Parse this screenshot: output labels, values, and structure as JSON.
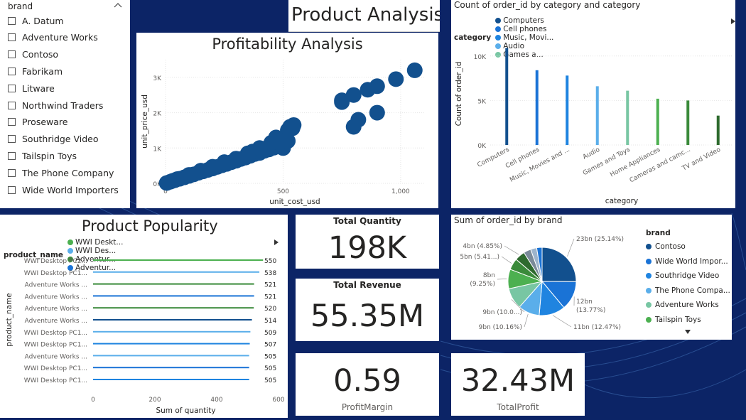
{
  "colors": {
    "background": "#0c2466",
    "scatter": "#12508e",
    "category_colors": [
      "#12508e",
      "#1a73d6",
      "#1f84e0",
      "#5aaeea",
      "#78c6a3",
      "#4cb050",
      "#3a8a3a",
      "#2e6a2e"
    ]
  },
  "brand_slicer": {
    "title": "brand",
    "collapse_icon": "chevron-up-icon",
    "items": [
      "A. Datum",
      "Adventure Works",
      "Contoso",
      "Fabrikam",
      "Litware",
      "Northwind Traders",
      "Proseware",
      "Southridge Video",
      "Tailspin Toys",
      "The Phone Company",
      "Wide World Importers"
    ]
  },
  "page_title": "Product Analysis",
  "profitability": {
    "title": "Profitability Analysis",
    "chart_data": {
      "type": "scatter",
      "title": "Profitability Analysis",
      "xlabel": "unit_cost_usd",
      "ylabel": "unit_price_usd",
      "x_ticks": [
        "0",
        "500",
        "1,000"
      ],
      "y_ticks": [
        "0K",
        "1K",
        "2K",
        "3K"
      ],
      "xlim": [
        0,
        1100
      ],
      "ylim": [
        0,
        3500
      ],
      "points": [
        [
          5,
          10
        ],
        [
          20,
          45
        ],
        [
          40,
          90
        ],
        [
          60,
          130
        ],
        [
          80,
          170
        ],
        [
          100,
          210
        ],
        [
          120,
          255
        ],
        [
          140,
          300
        ],
        [
          160,
          340
        ],
        [
          180,
          380
        ],
        [
          200,
          420
        ],
        [
          220,
          465
        ],
        [
          240,
          510
        ],
        [
          260,
          550
        ],
        [
          280,
          600
        ],
        [
          300,
          640
        ],
        [
          320,
          690
        ],
        [
          340,
          730
        ],
        [
          360,
          780
        ],
        [
          380,
          830
        ],
        [
          400,
          860
        ],
        [
          420,
          920
        ],
        [
          440,
          960
        ],
        [
          460,
          1010
        ],
        [
          480,
          1050
        ],
        [
          500,
          1110
        ],
        [
          510,
          1150
        ],
        [
          520,
          1500
        ],
        [
          540,
          1560
        ],
        [
          530,
          1600
        ],
        [
          545,
          1650
        ],
        [
          490,
          1200
        ],
        [
          470,
          1300
        ],
        [
          450,
          1150
        ],
        [
          430,
          1000
        ],
        [
          400,
          950
        ],
        [
          370,
          900
        ],
        [
          350,
          850
        ],
        [
          300,
          700
        ],
        [
          250,
          600
        ],
        [
          200,
          470
        ],
        [
          150,
          360
        ],
        [
          100,
          240
        ],
        [
          50,
          120
        ],
        [
          30,
          70
        ],
        [
          400,
          1000
        ],
        [
          500,
          1000
        ],
        [
          980,
          2950
        ],
        [
          1060,
          3200
        ],
        [
          750,
          2350
        ],
        [
          800,
          2500
        ],
        [
          860,
          2650
        ],
        [
          900,
          2750
        ],
        [
          750,
          2300
        ],
        [
          820,
          1800
        ],
        [
          800,
          1600
        ],
        [
          900,
          2000
        ],
        [
          520,
          1200
        ]
      ]
    }
  },
  "category_chart": {
    "title": "Count of order_id by category and category",
    "legend_label": "category",
    "legend_items": [
      {
        "name": "Computers",
        "color": "#12508e"
      },
      {
        "name": "Cell phones",
        "color": "#1a73d6"
      },
      {
        "name": "Music, Movi...",
        "color": "#1f84e0"
      },
      {
        "name": "Audio",
        "color": "#5aaeea"
      },
      {
        "name": "Games a...",
        "color": "#78c6a3"
      }
    ],
    "legend_more_icon": "triangle-right-icon",
    "chart_data": {
      "type": "bar",
      "title": "Count of order_id by category and category",
      "xlabel": "category",
      "ylabel": "Count of order_id",
      "y_ticks": [
        "0K",
        "5K",
        "10K"
      ],
      "ylim": [
        0,
        11500
      ],
      "categories": [
        "Computers",
        "Cell phones",
        "Music, Movies and ...",
        "Audio",
        "Games and Toys",
        "Home Appliances",
        "Cameras and camc...",
        "TV and Video"
      ],
      "values": [
        10900,
        8400,
        7800,
        6600,
        6100,
        5200,
        5000,
        3300
      ],
      "colors": [
        "#12508e",
        "#1a73d6",
        "#1f84e0",
        "#5aaeea",
        "#78c6a3",
        "#4cb050",
        "#3a8a3a",
        "#2e6a2e"
      ]
    }
  },
  "popularity": {
    "title": "Product Popularity",
    "legend_label": "product_name",
    "legend_items": [
      {
        "name": "WWI Deskt...",
        "color": "#4cb050"
      },
      {
        "name": "WWI Des...",
        "color": "#5aaeea"
      },
      {
        "name": "Adventur...",
        "color": "#3a8a3a"
      },
      {
        "name": "Adventur...",
        "color": "#1a73d6"
      }
    ],
    "legend_more_icon": "triangle-right-icon",
    "chart_data": {
      "type": "bar",
      "orientation": "horizontal",
      "xlabel": "Sum of quantity",
      "ylabel": "product_name",
      "x_ticks": [
        "0",
        "200",
        "400",
        "600"
      ],
      "xlim": [
        0,
        600
      ],
      "categories": [
        "WWI Desktop PC2...",
        "WWI Desktop PC1...",
        "Adventure Works ...",
        "Adventure Works ...",
        "Adventure Works ...",
        "Adventure Works ...",
        "WWI Desktop PC1...",
        "WWI Desktop PC1...",
        "Adventure Works ...",
        "WWI Desktop PC1...",
        "WWI Desktop PC1..."
      ],
      "values": [
        550,
        538,
        521,
        521,
        520,
        514,
        509,
        507,
        505,
        505,
        505
      ],
      "colors": [
        "#4cb050",
        "#5aaeea",
        "#3a8a3a",
        "#1a73d6",
        "#3a8a3a",
        "#12508e",
        "#5aaeea",
        "#1f84e0",
        "#5aaeea",
        "#1a73d6",
        "#1f84e0"
      ]
    }
  },
  "kpis": {
    "total_quantity": {
      "title": "Total Quantity",
      "value": "198K"
    },
    "total_revenue": {
      "title": "Total Revenue",
      "value": "55.35M"
    },
    "profit_margin": {
      "value": "0.59",
      "label": "ProfitMargin"
    },
    "total_profit": {
      "value": "32.43M",
      "label": "TotalProfit"
    }
  },
  "brand_pie": {
    "title": "Sum of order_id by brand",
    "legend_label": "brand",
    "legend_items": [
      {
        "name": "Contoso",
        "color": "#12508e"
      },
      {
        "name": "Wide World Impor...",
        "color": "#1a73d6"
      },
      {
        "name": "Southridge Video",
        "color": "#1f84e0"
      },
      {
        "name": "The Phone Compa...",
        "color": "#5aaeea"
      },
      {
        "name": "Adventure Works",
        "color": "#78c6a3"
      },
      {
        "name": "Tailspin Toys",
        "color": "#4cb050"
      }
    ],
    "legend_more_icon": "triangle-down-icon",
    "chart_data": {
      "type": "pie",
      "title": "Sum of order_id by brand",
      "slices": [
        {
          "value": 25.14,
          "label": "23bn (25.14%)",
          "color": "#12508e"
        },
        {
          "value": 13.77,
          "label": "12bn (13.77%)",
          "color": "#1a73d6"
        },
        {
          "value": 12.47,
          "label": "11bn (12.47%)",
          "color": "#1f84e0"
        },
        {
          "value": 10.16,
          "label": "9bn (10.16%)",
          "color": "#5aaeea"
        },
        {
          "value": 10.0,
          "label": "9bn (10.0...)",
          "color": "#78c6a3"
        },
        {
          "value": 9.25,
          "label": "8bn (9.25%)",
          "color": "#4cb050"
        },
        {
          "value": 5.41,
          "label": "5bn (5.41...)",
          "color": "#3a8a3a"
        },
        {
          "value": 4.85,
          "label": "4bn (4.85%)",
          "color": "#2e6a2e"
        },
        {
          "value": 3.5,
          "label": "",
          "color": "#7a8a99"
        },
        {
          "value": 2.9,
          "label": "",
          "color": "#9db4cc"
        },
        {
          "value": 2.55,
          "label": "",
          "color": "#1a73d6"
        }
      ]
    }
  }
}
